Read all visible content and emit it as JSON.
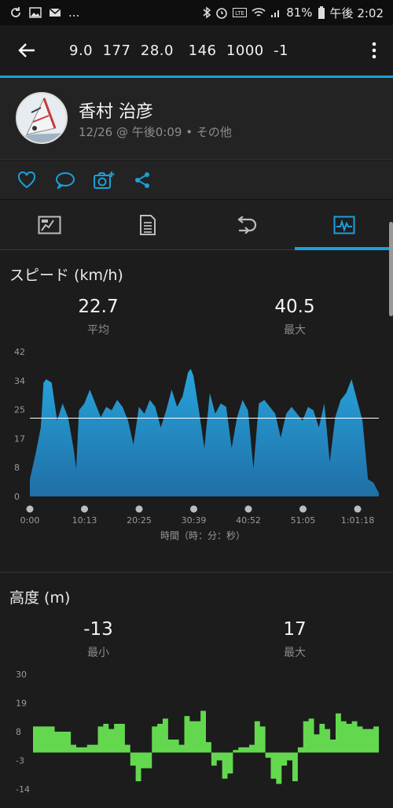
{
  "status_bar": {
    "dots": "...",
    "battery": "81%",
    "time": "午後 2:02"
  },
  "app_bar": {
    "title": "9.0  177  28.0   146  1000  -1"
  },
  "profile": {
    "name": "香村 治彦",
    "meta": "12/26 @ 午後0:09 • その他"
  },
  "actions": {
    "icons": [
      "heart-icon",
      "comment-icon",
      "camera-add-icon",
      "share-icon"
    ]
  },
  "tabs": {
    "items": [
      "summary-tab-icon",
      "details-tab-icon",
      "laps-tab-icon",
      "graph-tab-icon"
    ],
    "active_index": 3
  },
  "speed": {
    "title": "スピード (km/h)",
    "avg_value": "22.7",
    "avg_label": "平均",
    "max_value": "40.5",
    "max_label": "最大"
  },
  "altitude": {
    "title": "高度 (m)",
    "min_value": "-13",
    "min_label": "最小",
    "max_value": "17",
    "max_label": "最大"
  },
  "colors": {
    "accent": "#1ba0d8",
    "speed_fill_top": "#28a4dc",
    "speed_fill_bottom": "#1f6fa6",
    "altitude_fill": "#63d84f"
  },
  "chart_data": [
    {
      "type": "area",
      "title": "スピード (km/h)",
      "xlabel": "時間（時：分：秒）",
      "ylabel": "",
      "yticks": [
        "42",
        "34",
        "25",
        "17",
        "8",
        "0"
      ],
      "xticks": [
        "0:00",
        "10:13",
        "20:25",
        "30:39",
        "40:52",
        "51:05",
        "1:01:18"
      ],
      "ylim": [
        0,
        42
      ],
      "average_line": 22.7,
      "x_minutes": [
        0,
        1,
        2,
        2.5,
        3,
        4,
        5,
        6,
        7,
        8,
        8.5,
        9,
        10,
        11,
        12,
        13,
        14,
        15,
        16,
        17,
        18,
        19,
        20,
        21,
        22,
        23,
        24,
        25,
        26,
        27,
        28,
        29,
        29.5,
        30,
        31,
        32,
        33,
        34,
        35,
        36,
        37,
        38,
        39,
        40,
        41,
        42,
        43,
        44,
        45,
        46,
        47,
        48,
        49,
        50,
        51,
        52,
        53,
        54,
        55,
        56,
        57,
        58,
        59,
        60,
        61,
        62,
        63,
        64
      ],
      "values": [
        5,
        12,
        20,
        33,
        34,
        33,
        22,
        27,
        23,
        14,
        8,
        25,
        27,
        31,
        27,
        23,
        26,
        25,
        28,
        26,
        22,
        15,
        26,
        24,
        28,
        26,
        20,
        25,
        31,
        26,
        29,
        36,
        37,
        35,
        25,
        14,
        30,
        24,
        27,
        26,
        14,
        23,
        28,
        25,
        8,
        27,
        28,
        26,
        24,
        17,
        24,
        26,
        24,
        22,
        26,
        25,
        20,
        27,
        10,
        23,
        28,
        30,
        34,
        28,
        22,
        5,
        4,
        1
      ],
      "grid": false
    },
    {
      "type": "area",
      "title": "高度 (m)",
      "yticks": [
        "30",
        "19",
        "8",
        "-3",
        "-14"
      ],
      "ylim": [
        -14,
        30
      ],
      "x_minutes": [
        0,
        2,
        4,
        5,
        7,
        8,
        10,
        12,
        13,
        14,
        15,
        17,
        18,
        19,
        20,
        22,
        23,
        24,
        25,
        27,
        28,
        29,
        30,
        31,
        32,
        33,
        34,
        35,
        36,
        37,
        38,
        39,
        40,
        41,
        42,
        43,
        44,
        45,
        46,
        47,
        48,
        49,
        50,
        51,
        52,
        53,
        54,
        55,
        56,
        57,
        58,
        59,
        60,
        61,
        62,
        63,
        64
      ],
      "values": [
        10,
        10,
        8,
        8,
        3,
        2,
        3,
        10,
        11,
        9,
        11,
        3,
        -5,
        -11,
        -6,
        10,
        11,
        13,
        5,
        3,
        14,
        12,
        12,
        16,
        4,
        -5,
        -3,
        -10,
        -8,
        1,
        2,
        2,
        3,
        12,
        10,
        -2,
        -10,
        -12,
        -5,
        -3,
        -11,
        2,
        12,
        13,
        7,
        11,
        9,
        5,
        15,
        12,
        11,
        12,
        10,
        9,
        9,
        10,
        9
      ],
      "grid": false
    }
  ]
}
